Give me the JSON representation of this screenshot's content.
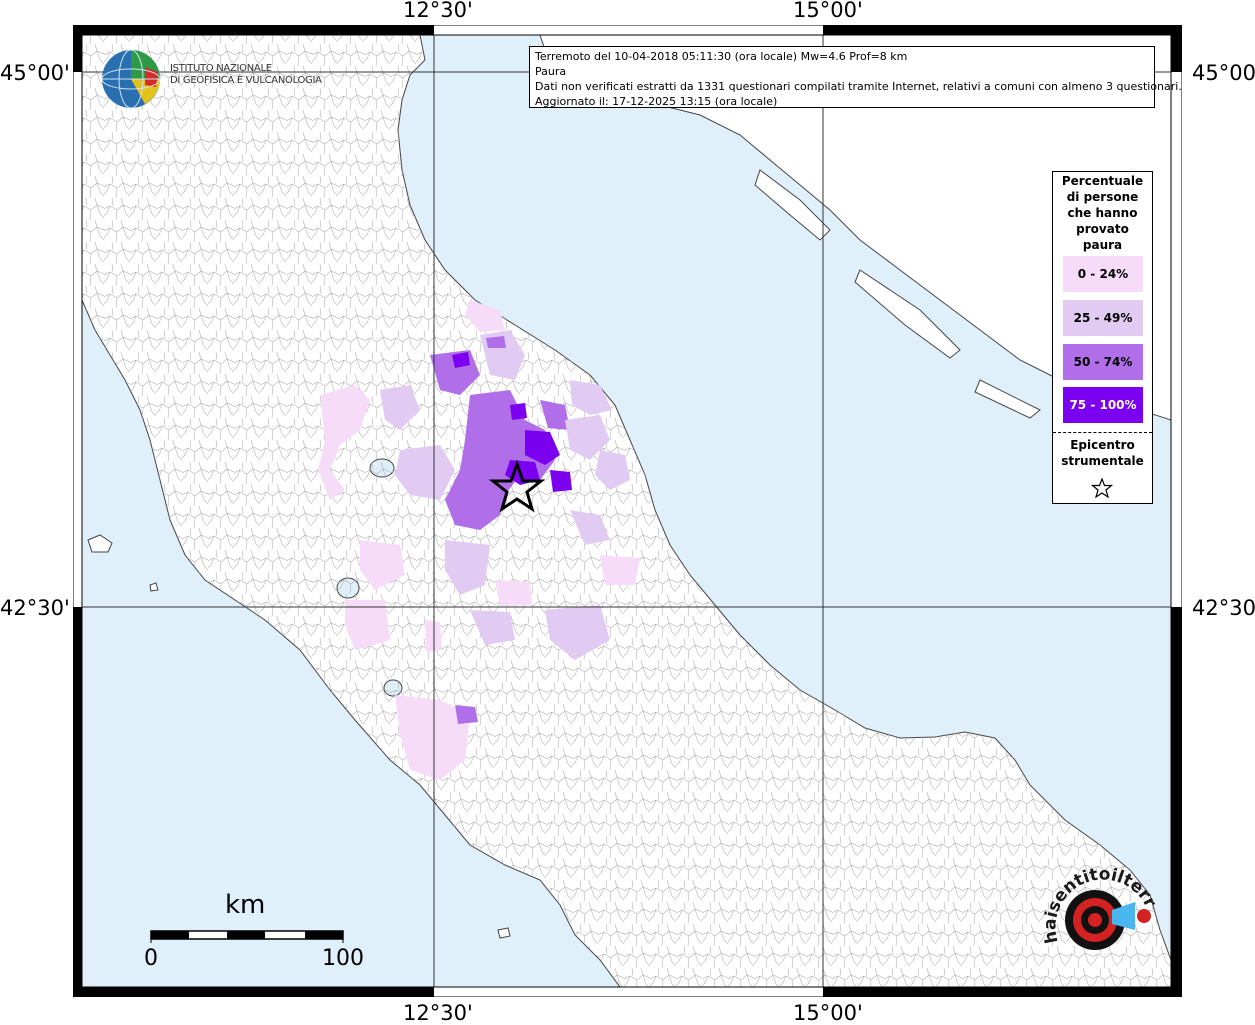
{
  "coords": {
    "top_left": "12°30'",
    "top_right": "15°00'",
    "bottom_left": "12°30'",
    "bottom_right": "15°00'",
    "left_top": "45°00'",
    "left_bottom": "42°30'",
    "right_top": "45°00'",
    "right_bottom": "42°30'"
  },
  "info": {
    "line1": "Terremoto del 10-04-2018 05:11:30 (ora locale) Mw=4.6 Prof=8 km",
    "line2": "Paura",
    "line3": "Dati non verificati estratti da 1331 questionari compilati tramite Internet, relativi a comuni con almeno 3 questionari.",
    "line4": "Aggiornato il: 17-12-2025 13:15 (ora locale)"
  },
  "legend": {
    "title_lines": [
      "Percentuale",
      "di persone",
      "che hanno",
      "provato",
      "paura"
    ],
    "items": [
      {
        "label": "0 - 24%",
        "color": "#f6dcf8"
      },
      {
        "label": "25 - 49%",
        "color": "#e2cbf2"
      },
      {
        "label": "50 - 74%",
        "color": "#b06ee8"
      },
      {
        "label": "75 - 100%",
        "color": "#7c00f0"
      }
    ],
    "epicenter_lines": [
      "Epicentro",
      "strumentale"
    ]
  },
  "ingv": {
    "line1": "ISTITUTO NAZIONALE",
    "line2": "DI GEOFISICA E VULCANOLOGIA"
  },
  "scale": {
    "unit": "km",
    "min": "0",
    "max": "100"
  },
  "hsi_logo": {
    "text": "haisentitoilterremoto.it"
  },
  "colors": {
    "sea": "#dff0fb",
    "land": "#ffffff",
    "border": "#9a9a9a"
  }
}
